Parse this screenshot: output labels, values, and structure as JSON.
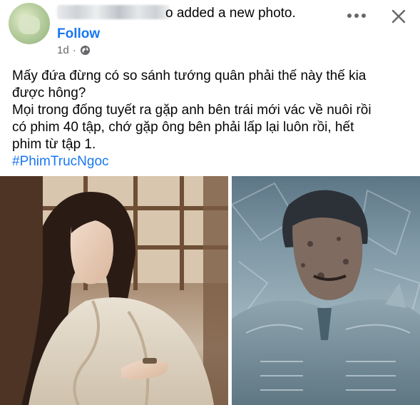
{
  "header": {
    "action_text": "o added a new photo.",
    "follow_label": "Follow",
    "time": "1d",
    "separator": "·"
  },
  "post": {
    "lines": [
      "Mấy đứa đừng có so sánh tướng quân phải thế này thế kia",
      "được hông?",
      "Mọi trong đống tuyết ra gặp anh bên trái mới vác về nuôi rồi",
      "có phim 40 tập, chớ gặp ông bên phải lấp lại luôn rồi, hết",
      "phim từ tập 1."
    ],
    "hashtag": "#PhimTrucNgoc"
  },
  "icons": {
    "more": "more-horizontal-icon",
    "close": "close-icon",
    "privacy": "globe-icon"
  },
  "colors": {
    "link": "#1877f2",
    "text": "#050505",
    "secondary": "#65676b"
  }
}
